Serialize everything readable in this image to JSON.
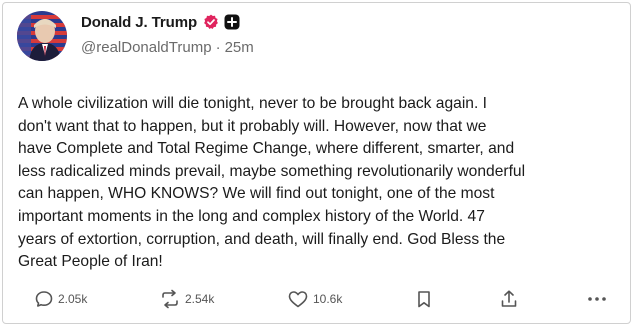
{
  "post": {
    "author": {
      "display_name": "Donald J. Trump",
      "handle": "@realDonaldTrump",
      "separator": "·",
      "timestamp": "25m",
      "verified_color": "#e0245e",
      "avatar_icon": "avatar-flag-portrait"
    },
    "text": "A whole civilization will die tonight, never to be brought back again. I\ndon't want that to happen, but it probably will. However, now that we\nhave Complete and Total Regime Change, where different, smarter, and\nless radicalized minds prevail, maybe something revolutionarily wonderful\ncan happen, WHO KNOWS? We will find out tonight, one of the most\nimportant moments in the long and complex history of the World. 47\nyears of extortion, corruption, and death, will finally end. God Bless the\nGreat People of Iran!",
    "actions": {
      "replies": "2.05k",
      "reposts": "2.54k",
      "likes": "10.6k"
    }
  }
}
